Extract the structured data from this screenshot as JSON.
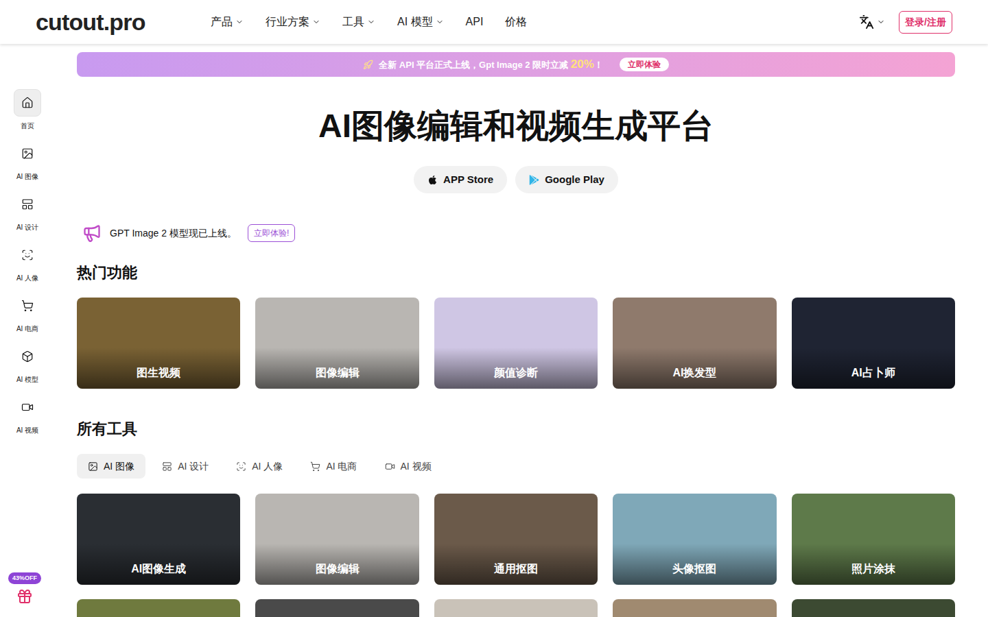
{
  "header": {
    "logo": "cutout.pro",
    "nav": [
      {
        "label": "产品",
        "dropdown": true
      },
      {
        "label": "行业方案",
        "dropdown": true
      },
      {
        "label": "工具",
        "dropdown": true
      },
      {
        "label": "AI 模型",
        "dropdown": true
      },
      {
        "label": "API",
        "dropdown": false
      },
      {
        "label": "价格",
        "dropdown": false
      }
    ],
    "login": "登录/注册"
  },
  "sidebar": {
    "items": [
      {
        "label": "首页",
        "selected": true
      },
      {
        "label": "AI 图像",
        "selected": false
      },
      {
        "label": "AI 设计",
        "selected": false
      },
      {
        "label": "AI 人像",
        "selected": false
      },
      {
        "label": "AI 电商",
        "selected": false
      },
      {
        "label": "AI 模型",
        "selected": false
      },
      {
        "label": "AI 视频",
        "selected": false
      }
    ],
    "promo_badge": "43%OFF"
  },
  "banner": {
    "text": "全新 API 平台正式上线，Gpt Image 2 限时立减 ",
    "highlight": "20%",
    "suffix": "！",
    "button": "立即体验"
  },
  "hero": {
    "title": "AI图像编辑和视频生成平台",
    "stores": [
      "APP Store",
      "Google Play"
    ]
  },
  "announcement": {
    "text": "GPT Image 2 模型现已上线。",
    "button": "立即体验!"
  },
  "hot": {
    "title": "热门功能",
    "cards": [
      {
        "label": "图生视频",
        "color": "#7a6234"
      },
      {
        "label": "图像编辑",
        "color": "#b9b6b2"
      },
      {
        "label": "颜值诊断",
        "color": "#cfc6e4"
      },
      {
        "label": "AI换发型",
        "color": "#8f7a6c"
      },
      {
        "label": "AI占卜师",
        "color": "#1f2433"
      }
    ]
  },
  "tools": {
    "title": "所有工具",
    "tabs": [
      {
        "label": "AI 图像",
        "selected": true
      },
      {
        "label": "AI 设计",
        "selected": false
      },
      {
        "label": "AI 人像",
        "selected": false
      },
      {
        "label": "AI 电商",
        "selected": false
      },
      {
        "label": "AI 视频",
        "selected": false
      }
    ],
    "cards": [
      {
        "label": "AI图像生成",
        "color": "#2a2e33"
      },
      {
        "label": "图像编辑",
        "color": "#b9b6b2"
      },
      {
        "label": "通用抠图",
        "color": "#6b5a4a"
      },
      {
        "label": "头像抠图",
        "color": "#7fa8b8"
      },
      {
        "label": "照片涂抹",
        "color": "#5e7a4a"
      }
    ],
    "more_cards": [
      {
        "color": "#6f7a3e"
      },
      {
        "color": "#4a4a4a"
      },
      {
        "color": "#c9c2b8"
      },
      {
        "color": "#a08a70"
      },
      {
        "color": "#3c4a32"
      }
    ]
  }
}
